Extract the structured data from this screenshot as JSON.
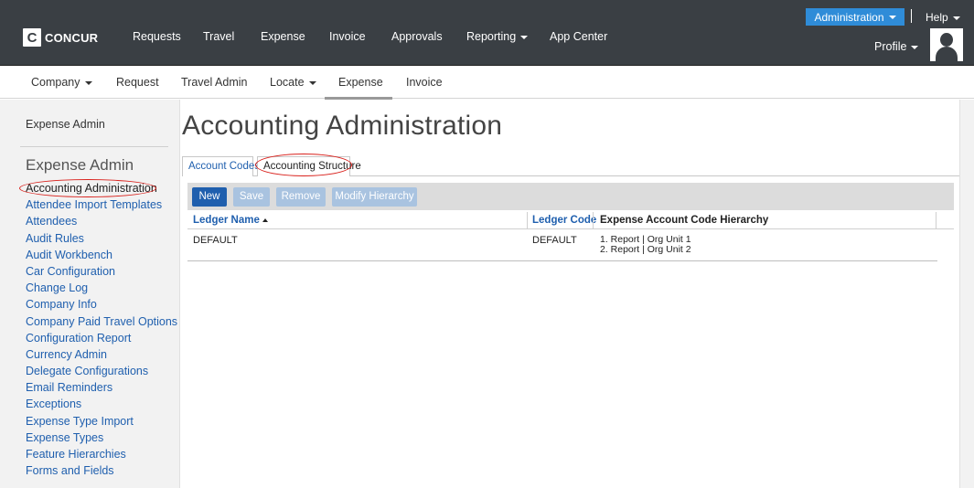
{
  "topbar": {
    "logo_mark": "C",
    "logo_word": "CONCUR",
    "nav": [
      "Requests",
      "Travel",
      "Expense",
      "Invoice",
      "Approvals",
      "Reporting",
      "App Center"
    ],
    "administration_label": "Administration",
    "help_label": "Help",
    "profile_label": "Profile"
  },
  "subnav": {
    "items": [
      "Company",
      "Request",
      "Travel Admin",
      "Locate",
      "Expense",
      "Invoice"
    ],
    "active": "Expense"
  },
  "sidebar": {
    "top_link": "Expense Admin",
    "heading": "Expense Admin",
    "items": [
      "Accounting Administration",
      "Attendee Import Templates",
      "Attendees",
      "Audit Rules",
      "Audit Workbench",
      "Car Configuration",
      "Change Log",
      "Company Info",
      "Company Paid Travel Options",
      "Configuration Report",
      "Currency Admin",
      "Delegate Configurations",
      "Email Reminders",
      "Exceptions",
      "Expense Type Import",
      "Expense Types",
      "Feature Hierarchies",
      "Forms and Fields"
    ],
    "active_index": 0
  },
  "main": {
    "title": "Accounting Administration",
    "tabs": [
      {
        "label": "Account Codes"
      },
      {
        "label": "Accounting Structure"
      }
    ],
    "toolbar": {
      "new_label": "New",
      "save_label": "Save",
      "remove_label": "Remove",
      "modify_label": "Modify Hierarchy"
    },
    "table": {
      "headers": [
        "Ledger Name",
        "Ledger Code",
        "Expense Account Code Hierarchy"
      ],
      "rows": [
        {
          "ledger_name": "DEFAULT",
          "ledger_code": "DEFAULT",
          "hierarchy": [
            "1. Report | Org Unit 1",
            "2. Report | Org Unit 2"
          ]
        }
      ]
    }
  },
  "colors": {
    "topbar_bg": "#3a3f44",
    "accent_blue": "#1f5fae",
    "admin_button": "#2f8cd8",
    "highlight_oval": "#d9211c"
  }
}
